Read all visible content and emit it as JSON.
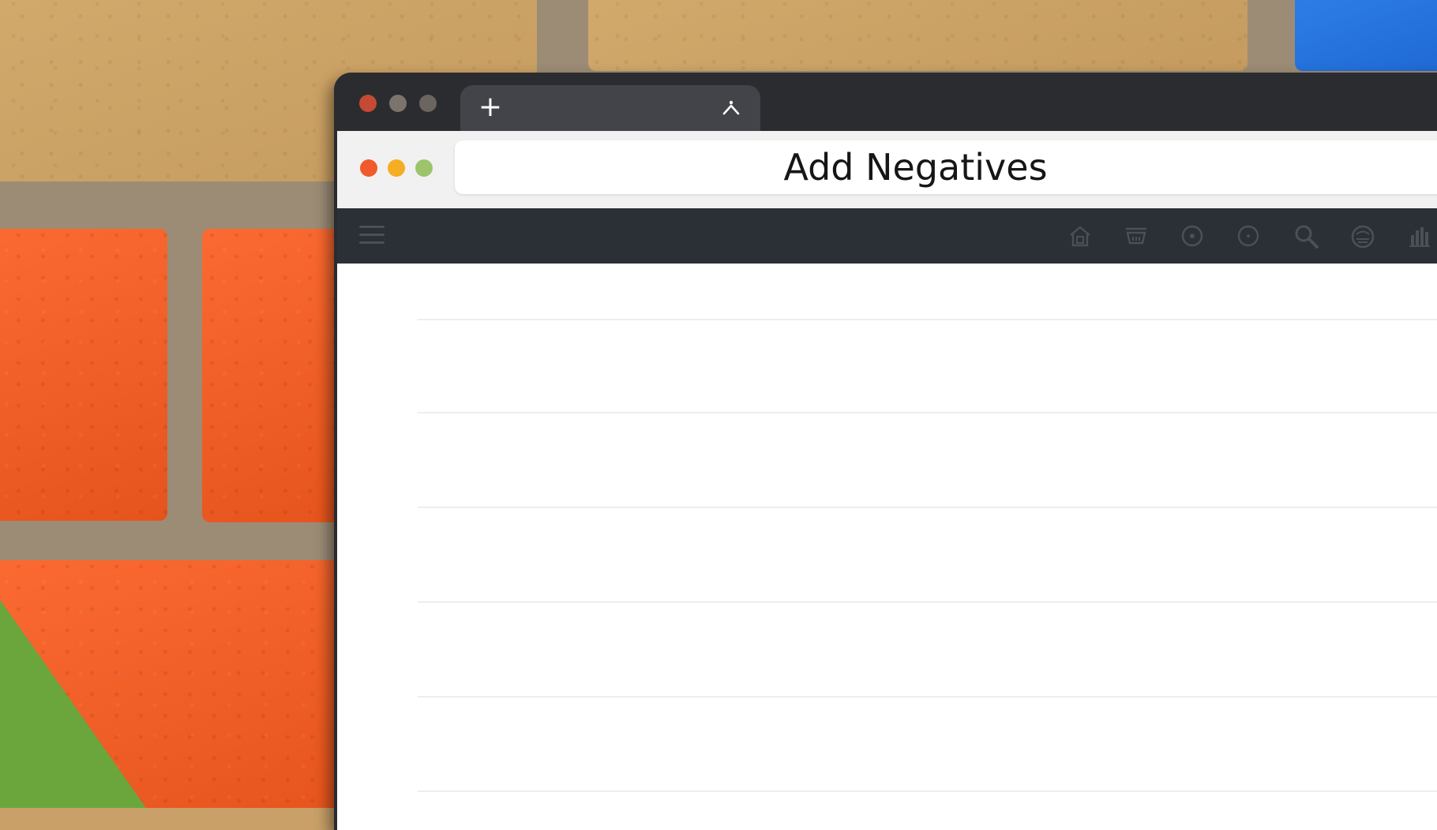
{
  "window": {
    "address_text": "Add Negatives",
    "tab": {
      "new_tab_icon": "plus-icon",
      "caret_icon": "caret-up-icon"
    }
  },
  "navbar": {
    "menu_icon": "menu-icon",
    "icons": [
      "home-icon",
      "inbox-icon",
      "target-icon",
      "circle-icon",
      "search-icon",
      "profile-icon",
      "chart-icon"
    ]
  },
  "content": {
    "rows": 6
  },
  "colors": {
    "tabstrip": "#2b2c2f",
    "tab": "#434449",
    "toolbar": "#f1f1f1",
    "navbar": "#2b2f36",
    "close": "#f05a2c",
    "minimize": "#f6ad23",
    "maximize": "#9cc46a"
  }
}
